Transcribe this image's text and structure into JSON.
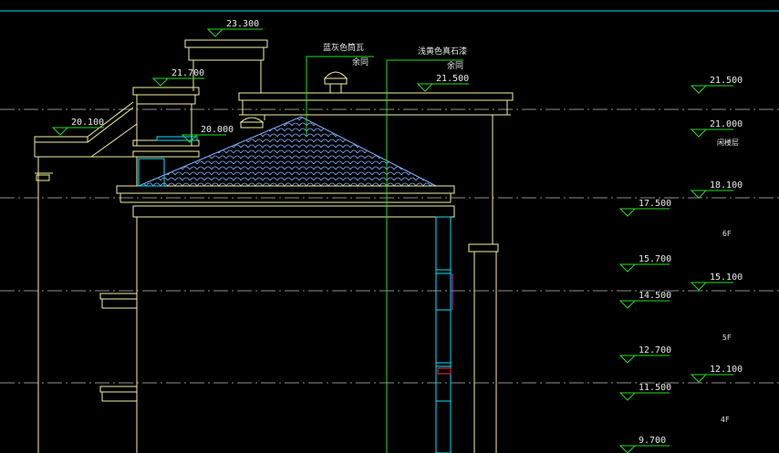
{
  "elevations_left": [
    {
      "label": "23.300"
    },
    {
      "label": "21.700"
    },
    {
      "label": "20.100"
    },
    {
      "label": "20.000"
    },
    {
      "label": "21.500"
    }
  ],
  "elevations_mid": [
    {
      "label": "17.500"
    },
    {
      "label": "15.700"
    },
    {
      "label": "14.500"
    },
    {
      "label": "12.700"
    },
    {
      "label": "11.500"
    },
    {
      "label": "9.700"
    }
  ],
  "elevations_right": [
    {
      "label": "21.500"
    },
    {
      "label": "21.000"
    },
    {
      "label": "18.100"
    },
    {
      "label": "15.100"
    },
    {
      "label": "12.100"
    }
  ],
  "floor_labels": {
    "roof": "闲楼层",
    "f6": "6F",
    "f5": "5F",
    "f4": "4F"
  },
  "notes": {
    "tile_line1": "蓝灰色筒瓦",
    "tile_line2": "余同",
    "stone_line1": "浅黄色真石漆",
    "stone_line2": "余同"
  },
  "colors": {
    "background": "#000000",
    "outline": "#f5f0a0",
    "cyan": "#00e5ff",
    "green": "#22dd22",
    "roof_hatch": "#7fb2ff",
    "centerline": "#bdbdbd",
    "text": "#e8e8e8",
    "magenta": "#d040d0",
    "red": "#ff3030"
  }
}
